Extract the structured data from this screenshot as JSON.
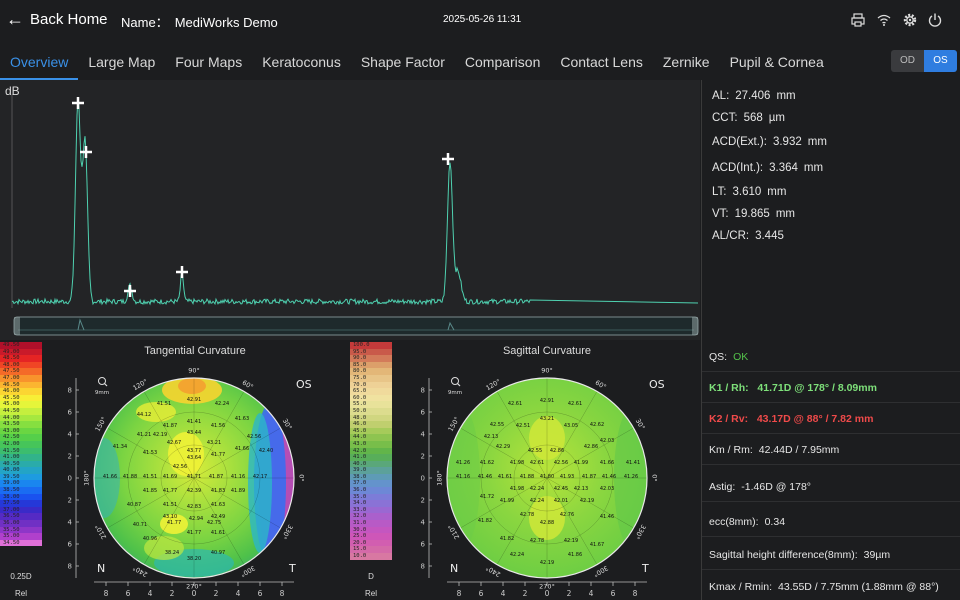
{
  "topbar": {
    "back_label": "Back Home",
    "name_label": "Name：",
    "name_value": "MediWorks Demo",
    "datetime": "2025-05-26 11:31"
  },
  "tabs": [
    "Overview",
    "Large Map",
    "Four Maps",
    "Keratoconus",
    "Shape Factor",
    "Comparison",
    "Contact Lens",
    "Zernike",
    "Pupil & Cornea"
  ],
  "eye": {
    "od": "OD",
    "os": "OS",
    "selected": "OS"
  },
  "ascan": {
    "unit_label": "dB",
    "line_color": "#4fd1b0"
  },
  "biometry": [
    {
      "label": "AL:",
      "value": "27.406",
      "unit": "mm"
    },
    {
      "label": "CCT:",
      "value": "568",
      "unit": "µm"
    },
    {
      "label": "ACD(Ext.):",
      "value": "3.932",
      "unit": "mm"
    },
    {
      "label": "ACD(Int.):",
      "value": "3.364",
      "unit": "mm"
    },
    {
      "label": "LT:",
      "value": "3.610",
      "unit": "mm"
    },
    {
      "label": "VT:",
      "value": "19.865",
      "unit": "mm"
    },
    {
      "label": "AL/CR:",
      "value": "3.445",
      "unit": ""
    }
  ],
  "maps": {
    "tangential": {
      "title": "Tangential Curvature",
      "eye": "OS",
      "scale_values": [
        "49.50",
        "49.00",
        "48.50",
        "48.00",
        "47.50",
        "47.00",
        "46.50",
        "46.00",
        "45.50",
        "45.00",
        "44.50",
        "44.00",
        "43.50",
        "43.00",
        "42.50",
        "42.00",
        "41.50",
        "41.00",
        "40.50",
        "40.00",
        "39.50",
        "39.00",
        "38.50",
        "38.00",
        "37.50",
        "37.00",
        "36.50",
        "36.00",
        "35.50",
        "35.00",
        "34.50"
      ],
      "step_label": "0.25D",
      "rel_label": "Rel"
    },
    "sagittal": {
      "title": "Sagittal Curvature",
      "eye": "OS",
      "scale_values": [
        "100.0",
        "95.0",
        "90.0",
        "85.0",
        "80.0",
        "75.0",
        "70.0",
        "65.0",
        "60.0",
        "55.0",
        "50.0",
        "48.0",
        "46.0",
        "45.0",
        "44.0",
        "43.0",
        "42.0",
        "41.0",
        "40.0",
        "39.0",
        "38.0",
        "37.0",
        "36.0",
        "35.0",
        "34.0",
        "33.0",
        "32.0",
        "31.0",
        "30.0",
        "25.0",
        "20.0",
        "15.0",
        "10.0"
      ],
      "step_label": "D",
      "rel_label": "Rel"
    },
    "common": {
      "zoom_label": "9mm",
      "angle_labels": [
        "90°",
        "60°",
        "30°",
        "0°",
        "330°",
        "300°",
        "270°",
        "240°",
        "210°",
        "180°",
        "150°",
        "120°"
      ],
      "n_label": "N",
      "t_label": "T",
      "ticks": [
        "8",
        "6",
        "4",
        "2",
        "0",
        "2",
        "4",
        "6",
        "8"
      ]
    }
  },
  "keratometry": {
    "qs_label": "QS:",
    "qs_value": "OK",
    "qs_color": "#54c24a",
    "k1": "K1 / Rh:   41.71D @ 178° / 8.09mm",
    "k1_color": "#7ee07a",
    "k2": "K2 / Rv:   43.17D @ 88° / 7.82 mm",
    "k2_color": "#ef4a4a",
    "km_label": "Km / Rm:",
    "km_value": "42.44D / 7.95mm",
    "astig_label": "Astig:",
    "astig_value": "-1.46D @ 178°",
    "ecc_label": "ecc(8mm):",
    "ecc_value": "0.34",
    "sag_label": "Sagittal height difference(8mm):",
    "sag_value": "39µm",
    "kmax_label": "Kmax / Rmin:",
    "kmax_value": "43.55D / 7.75mm (1.88mm @ 88°)"
  }
}
